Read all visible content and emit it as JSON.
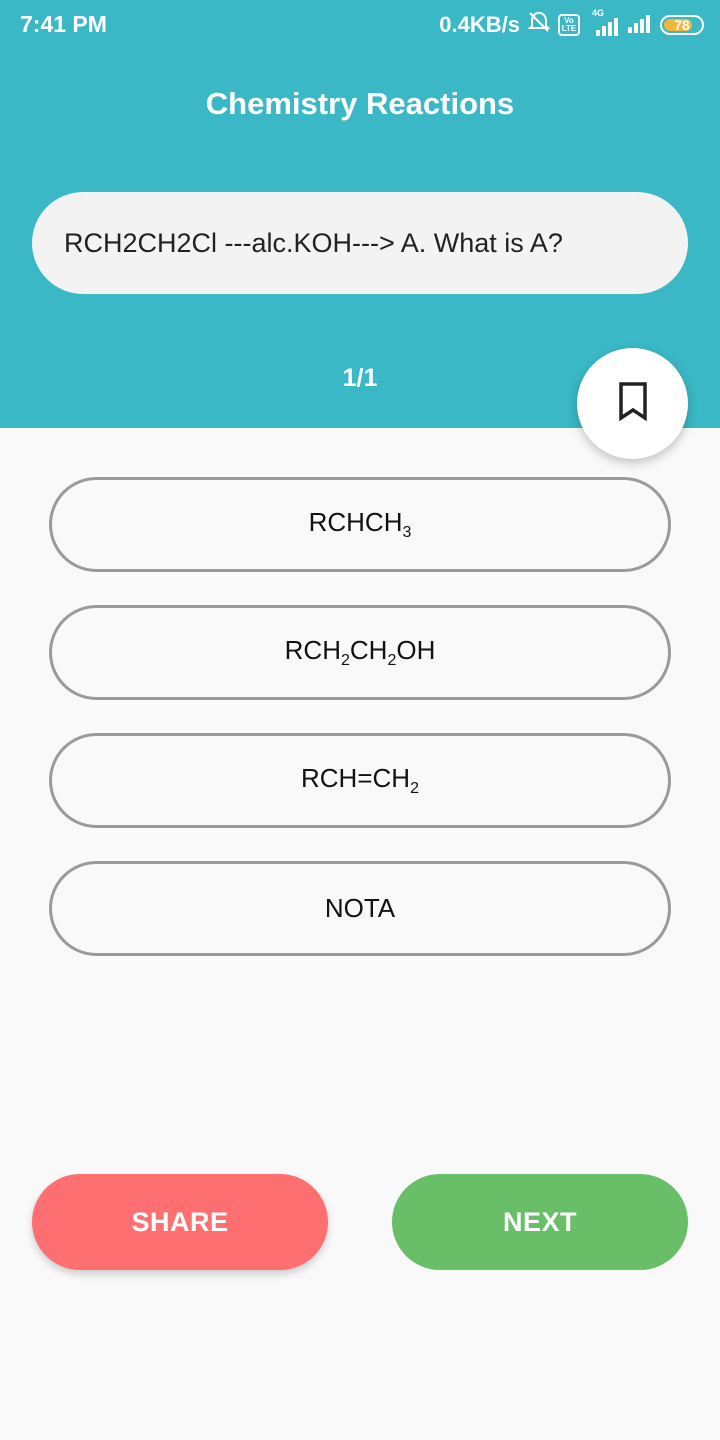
{
  "status_bar": {
    "time": "7:41 PM",
    "network_speed": "0.4KB/s",
    "volte_top": "Vo",
    "volte_bottom": "LTE",
    "network_type": "4G",
    "battery": "78",
    "battery_color": "#f4b53d"
  },
  "header": {
    "title": "Chemistry Reactions",
    "background_color": "#3ab8c5"
  },
  "question": {
    "text": "RCH2CH2Cl ---alc.KOH---> A. What is A?",
    "counter": "1/1",
    "bookmark_icon": "bookmark-outline-icon"
  },
  "options": [
    {
      "base": "RCHCH",
      "sub": "3"
    },
    {
      "part1": "RCH",
      "sub1": "2",
      "part2": "CH",
      "sub2": "2",
      "part3": "OH"
    },
    {
      "base": "RCH=CH",
      "sub": "2"
    },
    {
      "label": "NOTA"
    }
  ],
  "buttons": {
    "share_label": "SHARE",
    "share_color": "#fe6f72",
    "next_label": "NEXT",
    "next_color": "#68bf68"
  }
}
